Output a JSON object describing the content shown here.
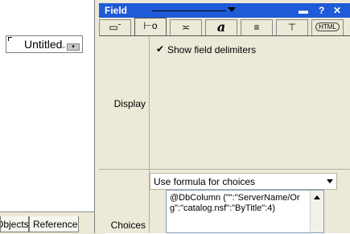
{
  "canvas": {
    "field_name": "Untitled"
  },
  "bottom_tabs": [
    {
      "label": "Objects"
    },
    {
      "label": "Reference"
    }
  ],
  "panel": {
    "title": "Field",
    "tabs": [
      {
        "icon": "basics-icon"
      },
      {
        "icon": "control-icon"
      },
      {
        "icon": "advanced-icon"
      },
      {
        "icon": "font-icon",
        "glyph": "a"
      },
      {
        "icon": "paragraph-icon"
      },
      {
        "icon": "hide-when-icon"
      },
      {
        "icon": "html-icon",
        "label": "HTML"
      }
    ],
    "display": {
      "label": "Display",
      "show_delimiters_checked": true,
      "show_delimiters_label": "Show field delimiters"
    },
    "choices": {
      "label": "Choices",
      "selected_option": "Use formula for choices",
      "formula": "@DbColumn (\"\":\"ServerName/Org\":\"catalog.nsf\":\"ByTitle\":4)"
    }
  },
  "colors": {
    "titlebar": "#1f5ad7",
    "panel_bg": "#ece9d8"
  }
}
